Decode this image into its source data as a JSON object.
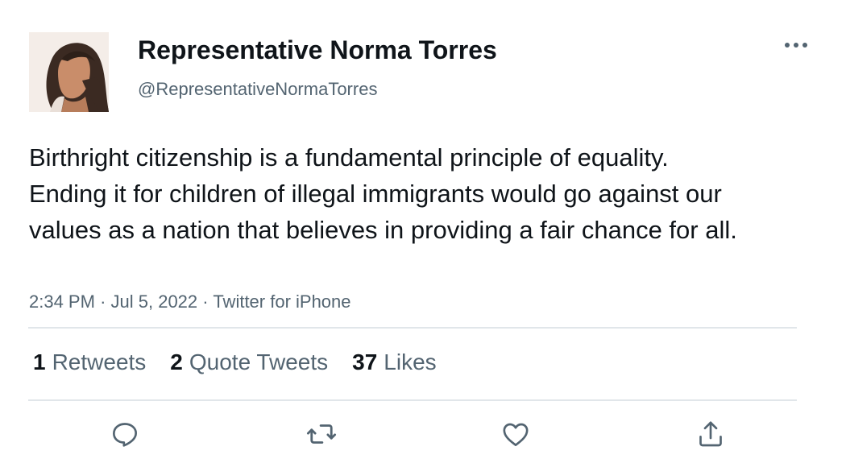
{
  "author": {
    "display_name": "Representative Norma Torres",
    "handle": "@RepresentativeNormaTorres",
    "avatar_icon": "profile-photo"
  },
  "tweet": {
    "text": "Birthright citizenship is a fundamental principle of equality. Ending it for children of illegal immigrants would go against our values as a nation that believes in providing a fair chance for all.",
    "time": "2:34 PM",
    "separator": "·",
    "date": "Jul 5, 2022",
    "source": "Twitter for iPhone"
  },
  "stats": {
    "retweets": {
      "count": "1",
      "label": "Retweets"
    },
    "quote_tweets": {
      "count": "2",
      "label": "Quote Tweets"
    },
    "likes": {
      "count": "37",
      "label": "Likes"
    }
  },
  "actions": {
    "reply_icon": "reply-icon",
    "retweet_icon": "retweet-icon",
    "like_icon": "heart-icon",
    "share_icon": "share-icon",
    "more_icon": "more-icon"
  },
  "colors": {
    "text": "#0f1419",
    "secondary": "#536471",
    "divider": "#e1e6ea",
    "icon": "#536471"
  }
}
